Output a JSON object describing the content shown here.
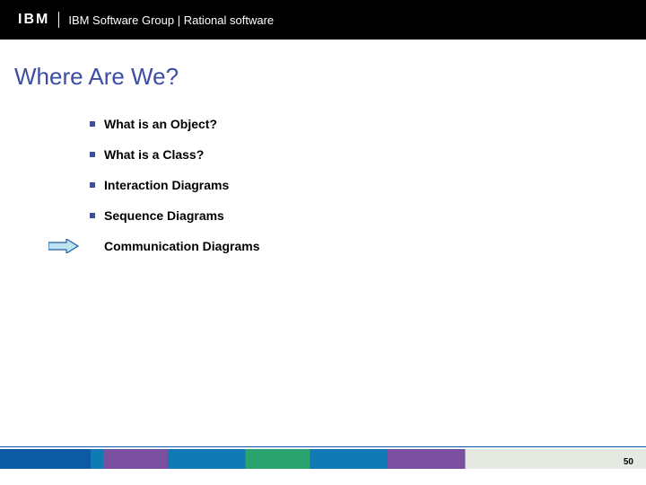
{
  "header": {
    "logo_text": "IBM",
    "title": "IBM Software Group | Rational software"
  },
  "title": "Where Are We?",
  "items": [
    {
      "label": "What is an Object?",
      "current": false
    },
    {
      "label": "What is a Class?",
      "current": false
    },
    {
      "label": "Interaction Diagrams",
      "current": false
    },
    {
      "label": "Sequence Diagrams",
      "current": false
    },
    {
      "label": "Communication Diagrams",
      "current": true
    }
  ],
  "page_number": "50"
}
